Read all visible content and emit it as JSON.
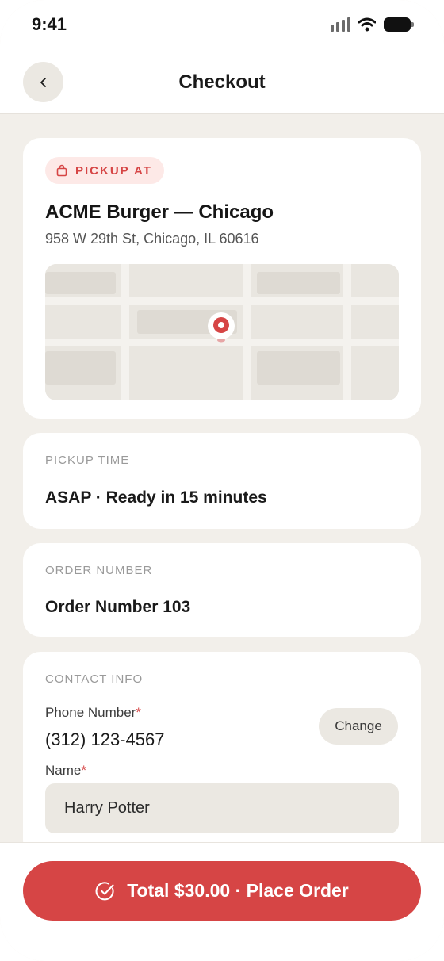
{
  "status_bar": {
    "time": "9:41"
  },
  "header": {
    "title": "Checkout"
  },
  "pickup": {
    "badge": "PICKUP AT",
    "store_name": "ACME Burger — Chicago",
    "address": "958 W 29th St, Chicago, IL 60616"
  },
  "pickup_time": {
    "label": "PICKUP TIME",
    "value": "ASAP · Ready in 15 minutes"
  },
  "order_number": {
    "label": "ORDER NUMBER",
    "value": "Order Number 103"
  },
  "contact": {
    "label": "CONTACT INFO",
    "phone_label": "Phone Number",
    "phone_value": "(312) 123-4567",
    "change_label": "Change",
    "name_label": "Name",
    "name_value": "Harry Potter",
    "required_mark": "*"
  },
  "footer": {
    "place_order_label": "Total $30.00 · Place Order"
  },
  "colors": {
    "accent": "#d64545",
    "background": "#f2efea",
    "card": "#ffffff",
    "badge_bg": "#fde9e7",
    "button_secondary": "#ebe8e2"
  },
  "icons": {
    "back": "chevron-left-icon",
    "badge": "bag-icon",
    "map_marker": "location-pin-icon",
    "submit": "check-circle-icon"
  }
}
